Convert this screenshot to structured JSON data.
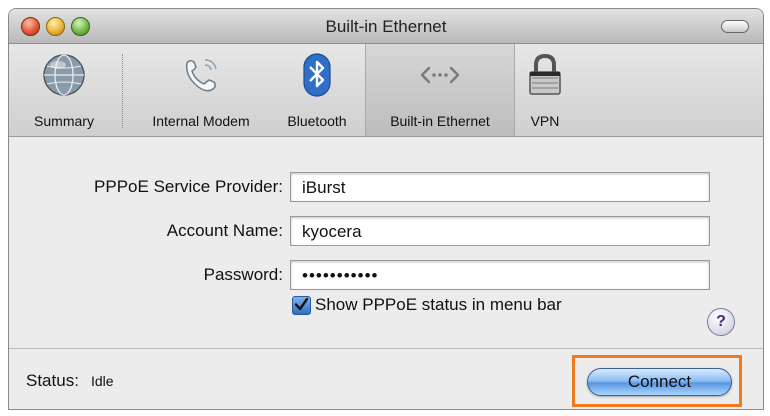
{
  "window": {
    "title": "Built-in Ethernet"
  },
  "toolbar": {
    "items": [
      {
        "label": "Summary",
        "icon": "globe-icon"
      },
      {
        "label": "Internal Modem",
        "icon": "phone-icon"
      },
      {
        "label": "Bluetooth",
        "icon": "bluetooth-icon"
      },
      {
        "label": "Built-in Ethernet",
        "icon": "ethernet-icon",
        "selected": true
      },
      {
        "label": "VPN",
        "icon": "lock-icon"
      }
    ]
  },
  "form": {
    "provider_label": "PPPoE Service Provider:",
    "provider_value": "iBurst",
    "account_label": "Account Name:",
    "account_value": "kyocera",
    "password_label": "Password:",
    "password_value": "•••••••••••",
    "show_status_label": "Show PPPoE status in menu bar",
    "show_status_checked": true
  },
  "help": {
    "glyph": "?"
  },
  "footer": {
    "status_label": "Status:",
    "status_value": "Idle",
    "connect_label": "Connect"
  },
  "colors": {
    "highlight": "#ee7a22",
    "accent": "#5b97e2"
  }
}
